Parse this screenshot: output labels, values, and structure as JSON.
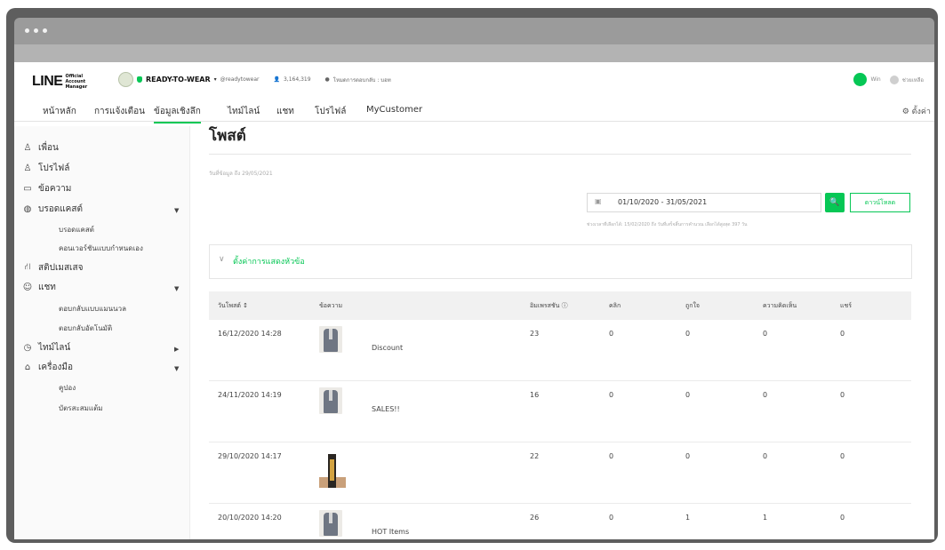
{
  "app": {
    "logo_main": "LINE",
    "logo_sub": "Official Account Manager"
  },
  "account": {
    "name": "READY-TO-WEAR",
    "id": "@readytowear",
    "friends": "3,164,319",
    "plan": "โหมดการตอบกลับ : บอท"
  },
  "top_right": {
    "user": "Win",
    "help": "ช่วยเหลือ"
  },
  "nav": {
    "tabs": [
      "หน้าหลัก",
      "การแจ้งเตือน",
      "ข้อมูลเชิงลึก",
      "ไทม์ไลน์",
      "แชท",
      "โปรไฟล์",
      "MyCustomer"
    ],
    "settings": "ตั้งค่า"
  },
  "sidebar": {
    "items": [
      {
        "label": "เพื่อน",
        "icon": "friends-icon"
      },
      {
        "label": "โปรไฟล์",
        "icon": "profile-icon"
      },
      {
        "label": "ข้อความ",
        "icon": "message-icon"
      },
      {
        "label": "บรอดแคสต์",
        "icon": "broadcast-icon"
      },
      {
        "label": "สติปเมสเสจ",
        "icon": "step-message-icon"
      },
      {
        "label": "แชท",
        "icon": "chat-icon"
      },
      {
        "label": "ไทม์ไลน์",
        "icon": "clock-icon"
      },
      {
        "label": "เครื่องมือ",
        "icon": "tools-icon"
      }
    ],
    "sub_broadcast": [
      "บรอดแคสต์",
      "คอนเวอร์ชันแบบกำหนดเอง"
    ],
    "sub_chat": [
      "ตอบกลับแบบแมนนวล",
      "ตอบกลับอัตโนมัติ"
    ],
    "sub_tools": [
      "คูปอง",
      "บัตรสะสมแต้ม"
    ]
  },
  "main": {
    "title": "โพสต์",
    "updated": "วันที่ข้อมูล ถึง 29/05/2021",
    "date_range": "01/10/2020 - 31/05/2021",
    "download": "ดาวน์โหลด",
    "note": "ช่วงเวลาที่เลือกได้: 15/02/2020 ถึง วันที่เสร็จสิ้นการคำนวณ เลือกได้สูงสุด 397 วัน",
    "display_settings": "ตั้งค่าการแสดงหัวข้อ"
  },
  "table": {
    "headers": [
      "วันโพสต์ ↕",
      "ข้อความ",
      "อิมเพรสชัน ⓘ",
      "คลิก",
      "ถูกใจ",
      "ความคิดเห็น",
      "แชร์"
    ],
    "rows": [
      {
        "date": "16/12/2020 14:28",
        "message": "Discount",
        "impressions": "23",
        "clicks": "0",
        "likes": "0",
        "comments": "0",
        "shares": "0"
      },
      {
        "date": "24/11/2020 14:19",
        "message": "SALES!!",
        "impressions": "16",
        "clicks": "0",
        "likes": "0",
        "comments": "0",
        "shares": "0"
      },
      {
        "date": "29/10/2020 14:17",
        "message": "",
        "impressions": "22",
        "clicks": "0",
        "likes": "0",
        "comments": "0",
        "shares": "0"
      },
      {
        "date": "20/10/2020 14:20",
        "message": "HOT Items",
        "impressions": "26",
        "clicks": "0",
        "likes": "1",
        "comments": "1",
        "shares": "0"
      }
    ]
  },
  "colors": {
    "accent": "#06c755",
    "frame": "#5e5e5e"
  }
}
